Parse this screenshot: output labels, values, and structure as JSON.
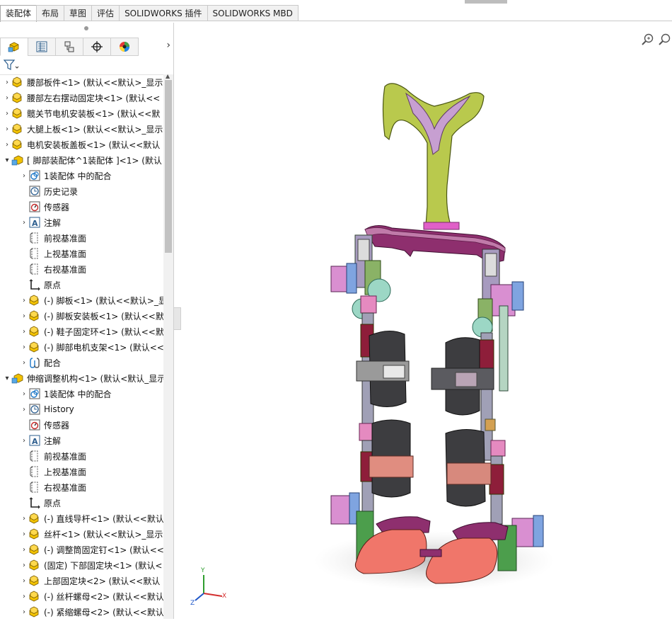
{
  "command_tabs": [
    "装配体",
    "布局",
    "草图",
    "评估",
    "SOLIDWORKS 插件",
    "SOLIDWORKS MBD"
  ],
  "active_tab": "装配体",
  "feature_manager": {
    "panel_tabs": [
      "feature-tree",
      "property-manager",
      "configuration-manager",
      "dimxpert",
      "display-manager"
    ],
    "tree": [
      {
        "level": 0,
        "expander": "right",
        "icon": "part-icon",
        "label": "腰部板件<1> (默认<<默认>_显示"
      },
      {
        "level": 0,
        "expander": "right",
        "icon": "part-icon",
        "label": "腰部左右摆动固定块<1> (默认<<"
      },
      {
        "level": 0,
        "expander": "right",
        "icon": "part-icon",
        "label": "髋关节电机安装板<1> (默认<<默"
      },
      {
        "level": 0,
        "expander": "right",
        "icon": "part-icon",
        "label": "大腿上板<1> (默认<<默认>_显示"
      },
      {
        "level": 0,
        "expander": "right",
        "icon": "part-icon",
        "label": "电机安装板盖板<1> (默认<<默认"
      },
      {
        "level": 0,
        "expander": "down",
        "icon": "assembly-icon",
        "label": "[ 脚部装配体^1装配体 ]<1> (默认"
      },
      {
        "level": 1,
        "expander": "right",
        "icon": "mates-icon",
        "label": "1装配体 中的配合"
      },
      {
        "level": 1,
        "expander": "",
        "icon": "history-icon",
        "label": "历史记录"
      },
      {
        "level": 1,
        "expander": "",
        "icon": "sensor-icon",
        "label": "传感器"
      },
      {
        "level": 1,
        "expander": "right",
        "icon": "annotation-icon",
        "label": "注解"
      },
      {
        "level": 1,
        "expander": "",
        "icon": "plane-icon",
        "label": "前视基准面"
      },
      {
        "level": 1,
        "expander": "",
        "icon": "plane-icon",
        "label": "上视基准面"
      },
      {
        "level": 1,
        "expander": "",
        "icon": "plane-icon",
        "label": "右视基准面"
      },
      {
        "level": 1,
        "expander": "",
        "icon": "origin-icon",
        "label": "原点"
      },
      {
        "level": 1,
        "expander": "right",
        "icon": "part-icon",
        "label": "(-) 脚板<1> (默认<<默认>_显"
      },
      {
        "level": 1,
        "expander": "right",
        "icon": "part-icon",
        "label": "(-) 脚板安装板<1> (默认<<默"
      },
      {
        "level": 1,
        "expander": "right",
        "icon": "part-icon",
        "label": "(-) 鞋子固定环<1> (默认<<默"
      },
      {
        "level": 1,
        "expander": "right",
        "icon": "part-icon",
        "label": "(-) 脚部电机支架<1> (默认<<"
      },
      {
        "level": 1,
        "expander": "right",
        "icon": "mate-clip-icon",
        "label": "配合"
      },
      {
        "level": 0,
        "expander": "down",
        "icon": "assembly-icon",
        "label": "伸缩调整机构<1> (默认<默认_显示"
      },
      {
        "level": 1,
        "expander": "right",
        "icon": "mates-icon",
        "label": "1装配体 中的配合"
      },
      {
        "level": 1,
        "expander": "right",
        "icon": "history-icon",
        "label": "History"
      },
      {
        "level": 1,
        "expander": "",
        "icon": "sensor-icon",
        "label": "传感器"
      },
      {
        "level": 1,
        "expander": "right",
        "icon": "annotation-icon",
        "label": "注解"
      },
      {
        "level": 1,
        "expander": "",
        "icon": "plane-icon",
        "label": "前视基准面"
      },
      {
        "level": 1,
        "expander": "",
        "icon": "plane-icon",
        "label": "上视基准面"
      },
      {
        "level": 1,
        "expander": "",
        "icon": "plane-icon",
        "label": "右视基准面"
      },
      {
        "level": 1,
        "expander": "",
        "icon": "origin-icon",
        "label": "原点"
      },
      {
        "level": 1,
        "expander": "right",
        "icon": "part-icon",
        "label": "(-) 直线导杆<1> (默认<<默认"
      },
      {
        "level": 1,
        "expander": "right",
        "icon": "part-icon",
        "label": "丝杆<1> (默认<<默认>_显示"
      },
      {
        "level": 1,
        "expander": "right",
        "icon": "part-icon",
        "label": "(-) 调整筒固定钉<1> (默认<<"
      },
      {
        "level": 1,
        "expander": "right",
        "icon": "part-icon",
        "label": "(固定) 下部固定块<1> (默认<"
      },
      {
        "level": 1,
        "expander": "right",
        "icon": "part-icon",
        "label": "上部固定块<2> (默认<<默认"
      },
      {
        "level": 1,
        "expander": "right",
        "icon": "part-icon",
        "label": "(-) 丝杆螺母<2> (默认<<默认"
      },
      {
        "level": 1,
        "expander": "right",
        "icon": "part-icon",
        "label": "(-) 紧缩螺母<2> (默认<<默认"
      }
    ]
  },
  "triad": {
    "x": "X",
    "y": "Y",
    "z": "Z"
  },
  "colors": {
    "part_yellow": "#f2c200",
    "frame_magenta": "#8e2f6e",
    "motor_pink": "#d98fd1",
    "cuff_dark": "#3d3d40",
    "foot_salmon": "#f0766a",
    "waist_olive": "#b9c94d"
  }
}
